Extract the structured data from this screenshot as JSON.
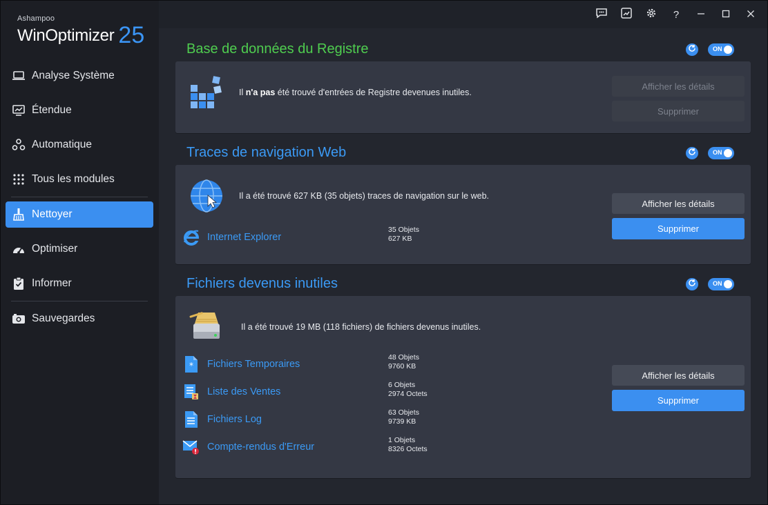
{
  "app": {
    "brand_small": "Ashampoo",
    "brand_main": "WinOptimizer",
    "brand_version": "25"
  },
  "sidebar": {
    "items": [
      {
        "label": "Analyse Système",
        "icon": "laptop-icon"
      },
      {
        "label": "Étendue",
        "icon": "monitor-chart-icon"
      },
      {
        "label": "Automatique",
        "icon": "automation-icon"
      },
      {
        "label": "Tous les modules",
        "icon": "grid-dots-icon"
      },
      {
        "label": "Nettoyer",
        "icon": "broom-icon",
        "active": true
      },
      {
        "label": "Optimiser",
        "icon": "speedometer-icon"
      },
      {
        "label": "Informer",
        "icon": "clipboard-icon"
      },
      {
        "label": "Sauvegardes",
        "icon": "camera-icon"
      }
    ]
  },
  "titlebar": {
    "feedback": "feedback-icon",
    "chart": "chart-icon",
    "settings": "gear-icon",
    "help": "?",
    "minimize": "—",
    "maximize": "☐",
    "close": "✕"
  },
  "toggle_label": "ON",
  "registry": {
    "title": "Base de données du Registre",
    "msg_pre": "Il ",
    "msg_bold": "n'a pas",
    "msg_post": " été trouvé d'entrées de Registre devenues inutiles.",
    "btn_details": "Afficher les détails",
    "btn_delete": "Supprimer"
  },
  "web": {
    "title": "Traces de navigation Web",
    "msg": "Il a été trouvé 627 KB (35 objets) traces de navigation sur le web.",
    "items": [
      {
        "label": "Internet Explorer",
        "objects": "35 Objets",
        "size": "627 KB"
      }
    ],
    "btn_details": "Afficher les détails",
    "btn_delete": "Supprimer"
  },
  "files": {
    "title": "Fichiers devenus inutiles",
    "msg": "Il a été trouvé 19 MB (118 fichiers) de fichiers devenus inutiles.",
    "items": [
      {
        "label": "Fichiers Temporaires",
        "objects": "48 Objets",
        "size": "9760 KB"
      },
      {
        "label": "Liste des Ventes",
        "objects": "6 Objets",
        "size": "2974 Octets"
      },
      {
        "label": "Fichiers Log",
        "objects": "63 Objets",
        "size": "9739 KB"
      },
      {
        "label": "Compte-rendus d'Erreur",
        "objects": "1 Objets",
        "size": "8326 Octets"
      }
    ],
    "btn_details": "Afficher les détails",
    "btn_delete": "Supprimer"
  },
  "colors": {
    "accent": "#3b8ff0",
    "title_green": "#4fcd4f",
    "title_blue": "#3b9af5"
  }
}
